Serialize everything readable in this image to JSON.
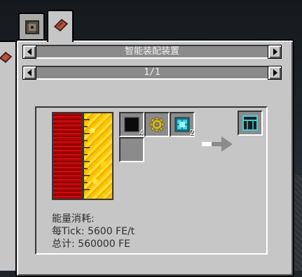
{
  "gui": {
    "selectors": {
      "recipe_name": "智能装配装置",
      "page": "1/1"
    }
  },
  "slots": [
    {
      "name": "input-slot-1",
      "icon": "black-block-icon",
      "count": "4"
    },
    {
      "name": "input-slot-2",
      "icon": "gear-icon",
      "count": ""
    },
    {
      "name": "input-slot-3",
      "icon": "cyan-circuit-icon",
      "count": "2"
    },
    {
      "name": "input-slot-4",
      "icon": "",
      "count": ""
    }
  ],
  "output": {
    "icon": "cyan-frame-block-icon",
    "count": ""
  },
  "energy": {
    "heading": "能量消耗:",
    "per_tick": "每Tick: 5600 FE/t",
    "total": "总计: 560000 FE"
  },
  "fluids": [
    {
      "name": "redstone-tank",
      "color": "#b30000"
    },
    {
      "name": "lava-tank",
      "color": "#ffc400"
    }
  ]
}
